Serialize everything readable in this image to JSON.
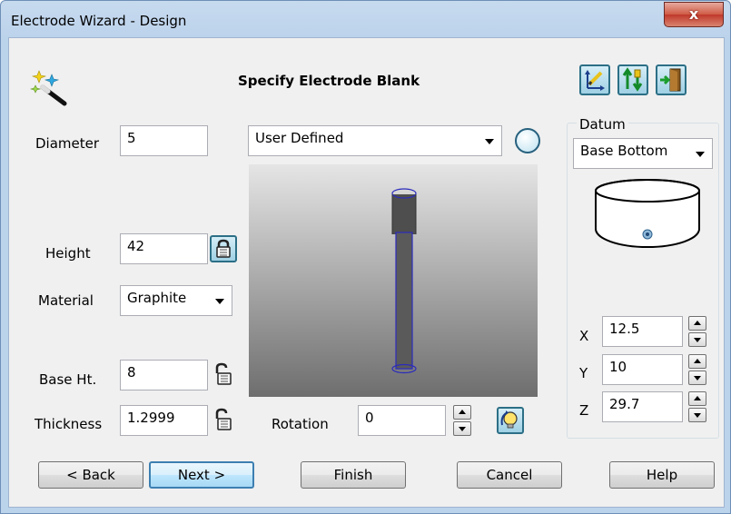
{
  "window": {
    "title": "Electrode Wizard - Design",
    "close_label": "x"
  },
  "heading": "Specify Electrode Blank",
  "fields": {
    "diameter": {
      "label": "Diameter",
      "value": "5"
    },
    "height": {
      "label": "Height",
      "value": "42"
    },
    "material": {
      "label": "Material",
      "value": "Graphite"
    },
    "base_ht": {
      "label": "Base Ht.",
      "value": "8"
    },
    "thickness": {
      "label": "Thickness",
      "value": "1.2999"
    },
    "rotation": {
      "label": "Rotation",
      "value": "0"
    }
  },
  "shape_combo": "User Defined",
  "datum": {
    "title": "Datum",
    "value": "Base Bottom",
    "x": {
      "label": "X",
      "value": "12.5"
    },
    "y": {
      "label": "Y",
      "value": "10"
    },
    "z": {
      "label": "Z",
      "value": "29.7"
    }
  },
  "buttons": {
    "back": "< Back",
    "next": "Next >",
    "finish": "Finish",
    "cancel": "Cancel",
    "help": "Help"
  },
  "icons": {
    "wizard": "magic-wand-icon",
    "toolbar": [
      "axis-edit-icon",
      "sort-properties-icon",
      "exit-door-icon"
    ],
    "shape": "circle-shape-icon",
    "lock": "padlock-icon",
    "rotate": "rotate-view-icon"
  }
}
